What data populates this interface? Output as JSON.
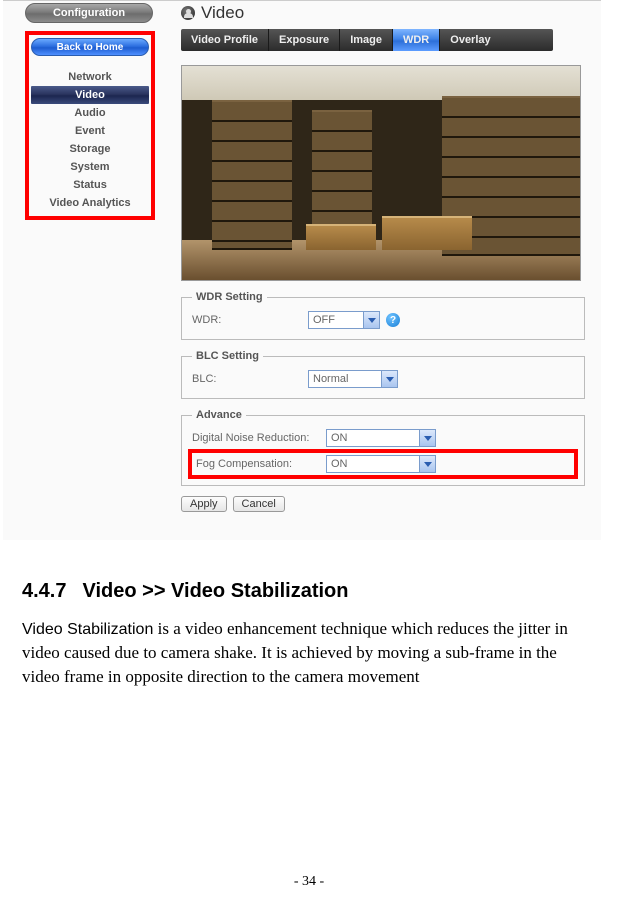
{
  "sidebar": {
    "config_label": "Configuration",
    "home_label": "Back to Home",
    "items": [
      {
        "label": "Network",
        "active": false
      },
      {
        "label": "Video",
        "active": true
      },
      {
        "label": "Audio",
        "active": false
      },
      {
        "label": "Event",
        "active": false
      },
      {
        "label": "Storage",
        "active": false
      },
      {
        "label": "System",
        "active": false
      },
      {
        "label": "Status",
        "active": false
      },
      {
        "label": "Video Analytics",
        "active": false
      }
    ]
  },
  "main": {
    "title": "Video",
    "tabs": [
      {
        "label": "Video Profile",
        "active": false
      },
      {
        "label": "Exposure",
        "active": false
      },
      {
        "label": "Image",
        "active": false
      },
      {
        "label": "WDR",
        "active": true
      },
      {
        "label": "Overlay",
        "active": false
      }
    ]
  },
  "wdr": {
    "legend": "WDR Setting",
    "label": "WDR:",
    "value": "OFF",
    "help": "?"
  },
  "blc": {
    "legend": "BLC Setting",
    "label": "BLC:",
    "value": "Normal"
  },
  "advance": {
    "legend": "Advance",
    "dnr_label": "Digital Noise Reduction:",
    "dnr_value": "ON",
    "fog_label": "Fog Compensation:",
    "fog_value": "ON"
  },
  "buttons": {
    "apply": "Apply",
    "cancel": "Cancel"
  },
  "doc": {
    "heading_num": "4.4.7",
    "heading_title": "Video >> Video Stabilization",
    "lead": "Video Stabilization",
    "body_rest": " is a video enhancement technique which reduces the jitter in video caused due to camera shake. It is achieved by moving a sub-frame in the video frame in opposite direction to the camera movement",
    "page_number": "- 34 -"
  }
}
